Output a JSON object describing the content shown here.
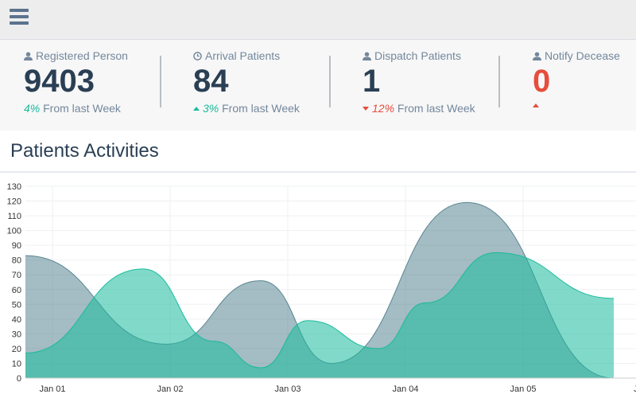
{
  "tiles": [
    {
      "label": "Registered Person",
      "value": "9403",
      "change": "4%",
      "change_text": "From last Week",
      "trend": "up",
      "icon": "user-icon"
    },
    {
      "label": "Arrival Patients",
      "value": "84",
      "change": "3%",
      "change_text": "From last Week",
      "trend": "up",
      "icon": "clock-icon"
    },
    {
      "label": "Dispatch Patients",
      "value": "1",
      "change": "12%",
      "change_text": "From last Week",
      "trend": "down",
      "icon": "user-icon"
    },
    {
      "label": "Notify Decease",
      "value": "0",
      "change": "",
      "change_text": "",
      "trend": "up",
      "icon": "user-icon"
    }
  ],
  "panel": {
    "title": "Patients Activities"
  },
  "colors": {
    "teal": "#1abb9c",
    "slate": "#5a8592",
    "navy": "#2a3f54",
    "red": "#e74c3c"
  },
  "chart_data": {
    "type": "area",
    "x_labels": [
      "Jan 01",
      "Jan 02",
      "Jan 03",
      "Jan 04",
      "Jan 05",
      "Jan"
    ],
    "ylim": [
      0,
      130
    ],
    "y_ticks": [
      0,
      10,
      20,
      30,
      40,
      50,
      60,
      70,
      80,
      90,
      100,
      110,
      120,
      130
    ],
    "grid": true,
    "series": [
      {
        "color": "#5a8592",
        "points": [
          [
            0,
            83
          ],
          [
            1.2,
            23
          ],
          [
            2,
            66
          ],
          [
            2.6,
            10
          ],
          [
            3.75,
            119
          ],
          [
            5,
            0
          ]
        ]
      },
      {
        "color": "#1abb9c",
        "points": [
          [
            0,
            17
          ],
          [
            1,
            74
          ],
          [
            1.6,
            25
          ],
          [
            2,
            7
          ],
          [
            2.4,
            39
          ],
          [
            3,
            20
          ],
          [
            3.4,
            51
          ],
          [
            4,
            85
          ],
          [
            5,
            54
          ]
        ]
      }
    ]
  }
}
